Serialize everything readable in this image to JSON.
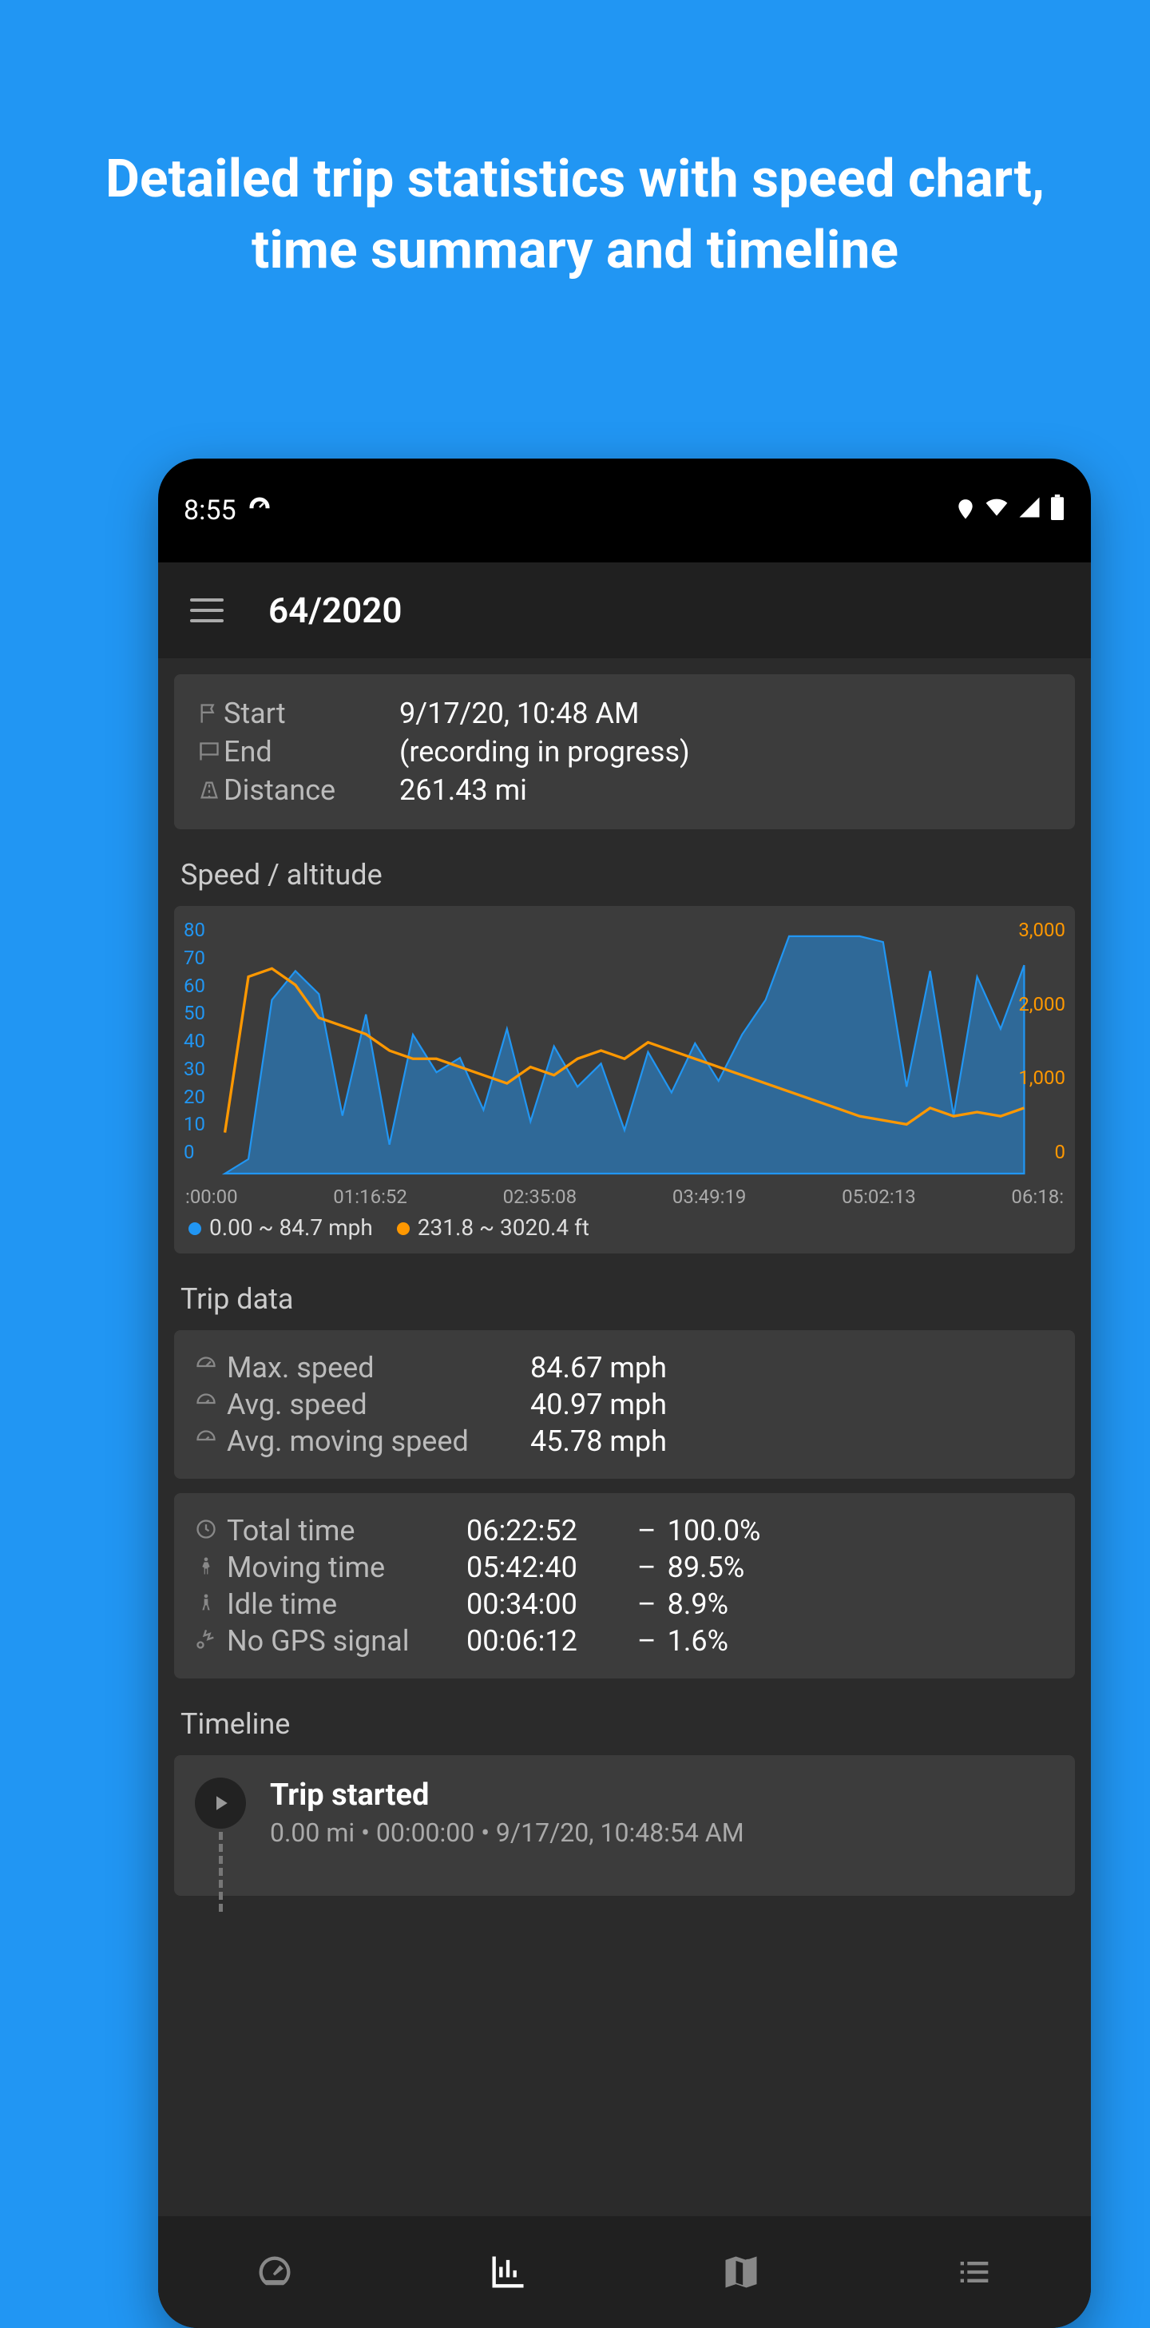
{
  "promo": {
    "title": "Detailed trip statistics with speed chart, time summary and timeline"
  },
  "status": {
    "time": "8:55",
    "icons": [
      "gauge",
      "location",
      "wifi",
      "signal",
      "battery"
    ]
  },
  "header": {
    "title": "64/2020"
  },
  "summary": {
    "start_label": "Start",
    "start_value": "9/17/20, 10:48 AM",
    "end_label": "End",
    "end_value": "(recording in progress)",
    "distance_label": "Distance",
    "distance_value": "261.43 mi"
  },
  "chart": {
    "section_title": "Speed / altitude",
    "legend_speed": "0.00 ~ 84.7 mph",
    "legend_alt": "231.8 ~ 3020.4 ft",
    "colors": {
      "speed": "#2196f3",
      "altitude": "#ff9800"
    }
  },
  "chart_data": {
    "type": "line",
    "x_ticks": [
      ":00:00",
      "01:16:52",
      "02:35:08",
      "03:49:19",
      "05:02:13",
      "06:18:"
    ],
    "series": [
      {
        "name": "speed_mph",
        "axis": "left",
        "y_ticks": [
          0,
          10,
          20,
          30,
          40,
          50,
          60,
          70,
          80
        ],
        "y_range": [
          0,
          85
        ],
        "values": [
          0,
          5,
          60,
          70,
          62,
          20,
          55,
          10,
          48,
          35,
          40,
          22,
          50,
          18,
          44,
          30,
          38,
          15,
          42,
          28,
          45,
          32,
          48,
          60,
          82,
          82,
          82,
          82,
          80,
          30,
          70,
          20,
          68,
          50,
          72
        ]
      },
      {
        "name": "altitude_ft",
        "axis": "right",
        "y_ticks": [
          0,
          1000,
          2000,
          3000
        ],
        "y_range": [
          0,
          3000
        ],
        "values": [
          500,
          2400,
          2500,
          2300,
          1900,
          1800,
          1700,
          1500,
          1400,
          1400,
          1300,
          1200,
          1100,
          1300,
          1200,
          1400,
          1500,
          1400,
          1600,
          1500,
          1400,
          1300,
          1200,
          1100,
          1000,
          900,
          800,
          700,
          650,
          600,
          800,
          700,
          750,
          700,
          800
        ]
      }
    ]
  },
  "tripdata": {
    "section_title": "Trip data",
    "rows": [
      {
        "label": "Max. speed",
        "value": "84.67 mph"
      },
      {
        "label": "Avg. speed",
        "value": "40.97 mph"
      },
      {
        "label": "Avg. moving speed",
        "value": "45.78 mph"
      }
    ]
  },
  "times": {
    "rows": [
      {
        "label": "Total time",
        "time": "06:22:52",
        "pct": "100.0%"
      },
      {
        "label": "Moving time",
        "time": "05:42:40",
        "pct": "89.5%"
      },
      {
        "label": "Idle time",
        "time": "00:34:00",
        "pct": "8.9%"
      },
      {
        "label": "No GPS signal",
        "time": "00:06:12",
        "pct": "1.6%"
      }
    ]
  },
  "timeline": {
    "section_title": "Timeline",
    "event_title": "Trip started",
    "event_sub": "0.00 mi • 00:00:00 • 9/17/20, 10:48:54 AM"
  },
  "nav": {
    "items": [
      "dashboard",
      "stats",
      "map",
      "list"
    ],
    "active": "stats"
  }
}
